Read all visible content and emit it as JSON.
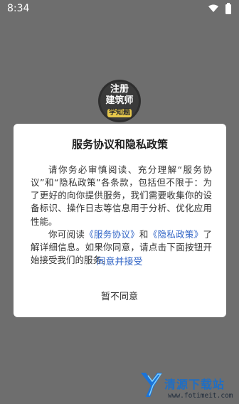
{
  "status_bar": {
    "time": "8:34"
  },
  "app": {
    "logo_lines": [
      "注册",
      "建筑师",
      "学知题"
    ]
  },
  "dialog": {
    "title": "服务协议和隐私政策",
    "paragraph1": "请你务必审慎阅读、充分理解“服务协议”和“隐私政策”各条款，包括但不限于：为了更好的向你提供服务，我们需要收集你的设备标识、操作日志等信息用于分析、优化应用性能。",
    "p2_before": "你可阅读",
    "link_service": "《服务协议》",
    "p2_and": "和",
    "link_privacy": "《隐私政策》",
    "p2_after": "了解详细信息。如果你同意，请点击下面按钮开始接受我们的服务。",
    "agree_button": "同意并接受",
    "disagree_button": "暂不同意"
  },
  "watermark": {
    "text": "清源下载站",
    "url": "www.fotimeit.com"
  },
  "colors": {
    "overlay": "#6e6e6e",
    "link": "#2f63c6",
    "dialog_bg": "#ffffff"
  }
}
